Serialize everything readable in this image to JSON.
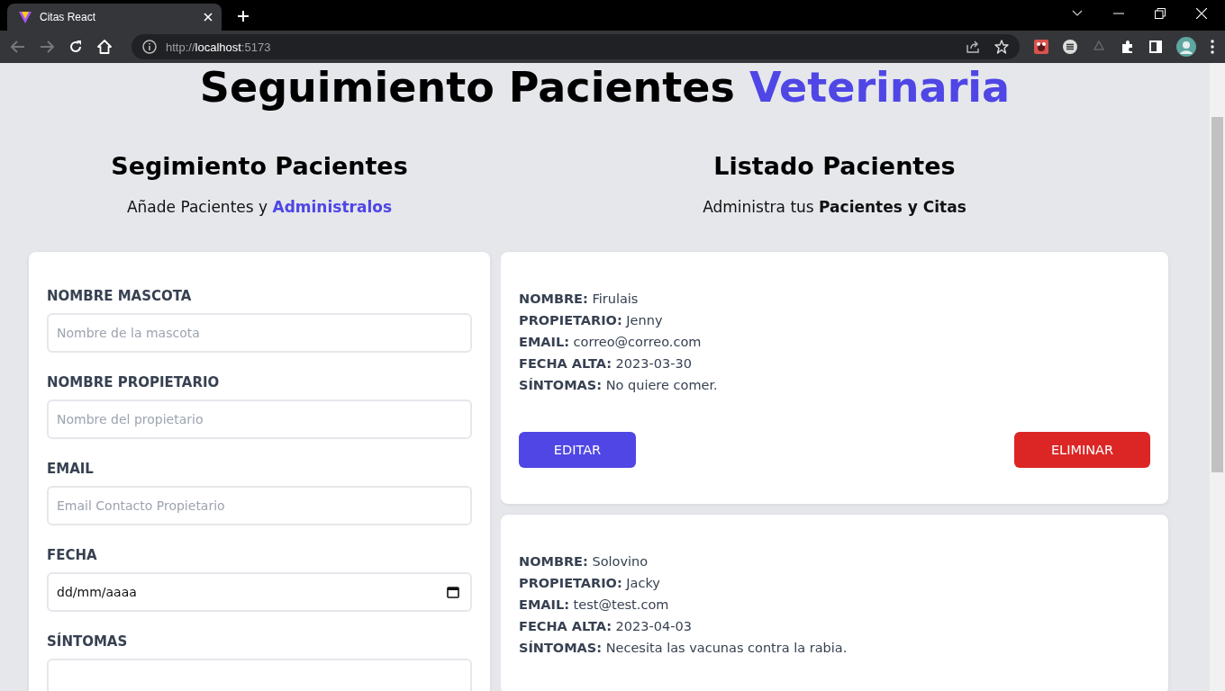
{
  "browser": {
    "tab_title": "Citas React",
    "url_scheme": "http://",
    "url_host": "localhost",
    "url_port": ":5173"
  },
  "header": {
    "title": "Seguimiento Pacientes",
    "title_accent": "Veterinaria"
  },
  "form_panel": {
    "heading": "Segimiento Pacientes",
    "subtitle": "Añade Pacientes y",
    "subtitle_accent": "Administralos",
    "fields": [
      {
        "kind": "text",
        "label": "NOMBRE MASCOTA",
        "placeholder": "Nombre de la mascota"
      },
      {
        "kind": "text",
        "label": "NOMBRE PROPIETARIO",
        "placeholder": "Nombre del propietario"
      },
      {
        "kind": "text",
        "label": "EMAIL",
        "placeholder": "Email Contacto Propietario"
      },
      {
        "kind": "date",
        "label": "FECHA",
        "value": "dd/mm/aaaa"
      },
      {
        "kind": "textarea",
        "label": "SÍNTOMAS"
      }
    ]
  },
  "list_panel": {
    "heading": "Listado Pacientes",
    "subtitle": "Administra tus **Pacientes y Citas**",
    "patients": [
      {
        "fields": [
          {
            "label": "NOMBRE:",
            "value": "Firulais"
          },
          {
            "label": "PROPIETARIO:",
            "value": "Jenny"
          },
          {
            "label": "EMAIL:",
            "value": "correo@correo.com"
          },
          {
            "label": "FECHA ALTA:",
            "value": "2023-03-30"
          },
          {
            "label": "SÍNTOMAS:",
            "value": "No quiere comer."
          }
        ],
        "edit_label": "EDITAR",
        "delete_label": "ELIMINAR"
      },
      {
        "fields": [
          {
            "label": "NOMBRE:",
            "value": "Solovino"
          },
          {
            "label": "PROPIETARIO:",
            "value": "Jacky"
          },
          {
            "label": "EMAIL:",
            "value": "test@test.com"
          },
          {
            "label": "FECHA ALTA:",
            "value": "2023-04-03"
          },
          {
            "label": "SÍNTOMAS:",
            "value": "Necesita las vacunas contra la rabia."
          }
        ]
      }
    ]
  }
}
